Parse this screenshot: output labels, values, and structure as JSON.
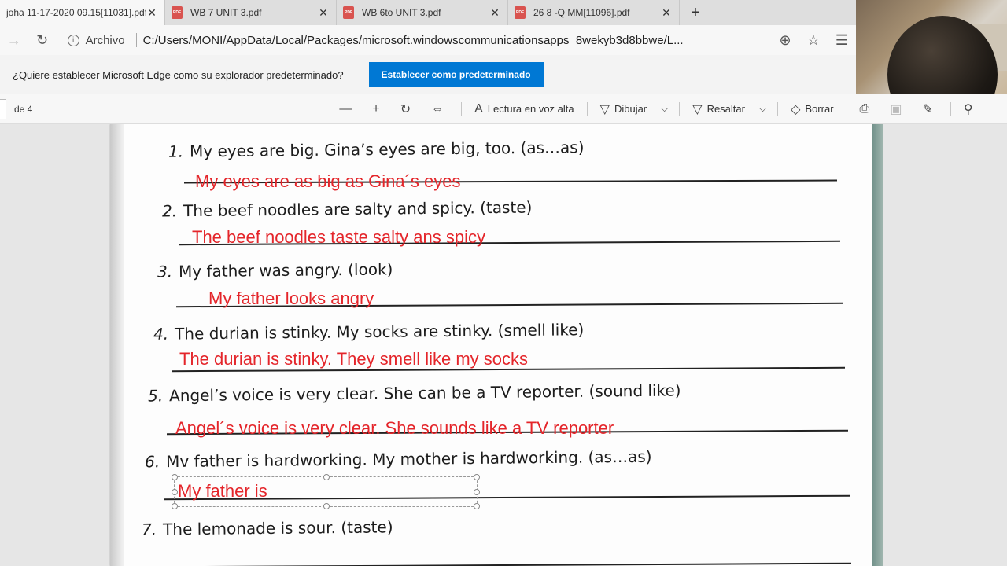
{
  "tabs": [
    {
      "label": "joha 11-17-2020 09.15[11031].pdf",
      "active": true
    },
    {
      "label": "WB 7 UNIT 3.pdf",
      "active": false
    },
    {
      "label": "WB 6to UNIT 3.pdf",
      "active": false
    },
    {
      "label": "26 8 -Q MM[11096].pdf",
      "active": false
    }
  ],
  "pdf_badge": "PDF",
  "address": {
    "scheme_label": "Archivo",
    "url": "C:/Users/MONI/AppData/Local/Packages/microsoft.windowscommunicationsapps_8wekyb3d8bbwe/L..."
  },
  "banner": {
    "message": "¿Quiere establecer Microsoft Edge como su explorador predeterminado?",
    "button": "Establecer como predeterminado"
  },
  "pdf_toolbar": {
    "page_count": "de 4",
    "read_aloud": "Lectura en voz alta",
    "draw": "Dibujar",
    "highlight": "Resaltar",
    "erase": "Borrar"
  },
  "exercise": {
    "questions": [
      {
        "num": "1.",
        "text": "My eyes are big. Gina’s eyes are big, too. (as…as)"
      },
      {
        "num": "2.",
        "text": "The beef noodles are salty and spicy. (taste)"
      },
      {
        "num": "3.",
        "text": "My father was angry. (look)"
      },
      {
        "num": "4.",
        "text": "The durian is stinky. My socks are stinky. (smell like)"
      },
      {
        "num": "5.",
        "text": "Angel’s voice is very clear. She can be a TV reporter. (sound like)"
      },
      {
        "num": "6.",
        "text": "Mv father is hardworking. My mother is hardworking. (as…as)"
      },
      {
        "num": "7.",
        "text": "The lemonade is sour. (taste)"
      }
    ],
    "answers": [
      "My eyes are as big as Gina´s eyes",
      "The beef noodles taste salty ans spicy",
      "My father looks angry",
      "The durian is stinky. They smell like my socks",
      "Angel´s voice is very clear. She sounds like a TV reporter",
      "My father is"
    ]
  },
  "colors": {
    "answer_red": "#e4252a",
    "edge_blue": "#0078d4"
  }
}
